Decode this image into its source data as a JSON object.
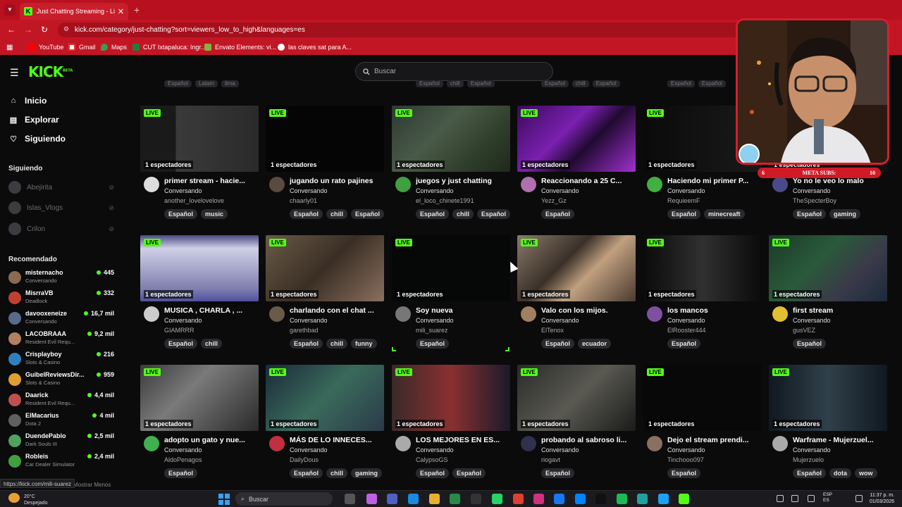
{
  "browser": {
    "tab_title": "Just Chatting Streaming - Live S",
    "tab_close": "✕",
    "new_tab": "+",
    "url": "kick.com/category/just-chatting?sort=viewers_low_to_high&languages=es",
    "bookmarks": [
      "YouTube",
      "Gmail",
      "Maps",
      "CUT Ixtapaluca: Ingr...",
      "Envato Elements: vi...",
      "las claves sat para A..."
    ]
  },
  "header": {
    "logo": "KICK",
    "logo_badge": "BETA",
    "search_placeholder": "Buscar"
  },
  "sidebar": {
    "nav": [
      {
        "label": "Inicio",
        "icon": "home-icon"
      },
      {
        "label": "Explorar",
        "icon": "explore-icon"
      },
      {
        "label": "Siguiendo",
        "icon": "heart-icon"
      }
    ],
    "following_title": "Siguiendo",
    "following": [
      "Abejirita",
      "Islas_Vlogs",
      "Crilon"
    ],
    "recommended_title": "Recomendado",
    "recommended": [
      {
        "name": "misternacho",
        "category": "Conversando",
        "viewers": "445"
      },
      {
        "name": "MisrraVB",
        "category": "Deadlock",
        "viewers": "332"
      },
      {
        "name": "davooxeneize",
        "category": "Conversando",
        "viewers": "16,7 mil"
      },
      {
        "name": "LACOBRAAA",
        "category": "Resident Evil Requ...",
        "viewers": "9,2 mil"
      },
      {
        "name": "Crisplayboy",
        "category": "Slots & Casino",
        "viewers": "216"
      },
      {
        "name": "GuibelReviewsDir...",
        "category": "Slots & Casino",
        "viewers": "959"
      },
      {
        "name": "Daarick",
        "category": "Resident Evil Requ...",
        "viewers": "4,4 mil"
      },
      {
        "name": "ElMacarius",
        "category": "Dota 2",
        "viewers": "4 mil"
      },
      {
        "name": "DuendePablo",
        "category": "Dark Souls III",
        "viewers": "2,5 mil"
      },
      {
        "name": "Robleis",
        "category": "Car Dealer Simulator",
        "viewers": "2,4 mil"
      }
    ],
    "show_more": "Mostrar Menos",
    "status_url": "https://kick.com/mili-suarez"
  },
  "cut_tags": [
    [
      "Español",
      "Latam",
      "lima"
    ],
    [],
    [
      "Español",
      "chill",
      "Español"
    ],
    [
      "Español",
      "chill",
      "Español"
    ],
    [
      "Español",
      "Español"
    ]
  ],
  "live_label": "LIVE",
  "streams": [
    {
      "title": "primer stream - hacie...",
      "category": "Conversando",
      "user": "another_lovelovelove",
      "viewers": "1 espectadores",
      "tags": [
        "Español",
        "music"
      ]
    },
    {
      "title": "jugando un rato pajines",
      "category": "Conversando",
      "user": "chaarly01",
      "viewers": "1 espectadores",
      "tags": [
        "Español",
        "chill",
        "Español"
      ]
    },
    {
      "title": "juegos y just chatting",
      "category": "Conversando",
      "user": "el_loco_chinete1991",
      "viewers": "1 espectadores",
      "tags": [
        "Español",
        "chill",
        "Español"
      ]
    },
    {
      "title": "Reaccionando a 25 C...",
      "category": "Conversando",
      "user": "Yezz_Gz",
      "viewers": "1 espectadores",
      "tags": [
        "Español"
      ]
    },
    {
      "title": "Haciendo mi primer P...",
      "category": "Conversando",
      "user": "RequieemF",
      "viewers": "1 espectadores",
      "tags": [
        "Español",
        "minecreaft"
      ]
    },
    {
      "title": "Yo no le veo lo malo",
      "category": "Conversando",
      "user": "TheSpecterBoy",
      "viewers": "1 espectadores",
      "tags": [
        "Español",
        "gaming"
      ]
    },
    {
      "title": "MUSICA , CHARLA , ...",
      "category": "Conversando",
      "user": "GIAMRRR",
      "viewers": "1 espectadores",
      "tags": [
        "Español",
        "chill"
      ]
    },
    {
      "title": "charlando con el chat ...",
      "category": "Conversando",
      "user": "garethbad",
      "viewers": "1 espectadores",
      "tags": [
        "Español",
        "chill",
        "funny"
      ]
    },
    {
      "title": "Soy nueva",
      "category": "Conversando",
      "user": "mili_suarez",
      "viewers": "1 espectadores",
      "tags": [
        "Español"
      ]
    },
    {
      "title": "Valo con los mijos.",
      "category": "Conversando",
      "user": "ElTenox",
      "viewers": "1 espectadores",
      "tags": [
        "Español",
        "ecuador"
      ]
    },
    {
      "title": "los mancos",
      "category": "Conversando",
      "user": "ElRooster444",
      "viewers": "1 espectadores",
      "tags": [
        "Español"
      ]
    },
    {
      "title": "first stream",
      "category": "Conversando",
      "user": "gusVEZ",
      "viewers": "1 espectadores",
      "tags": [
        "Español"
      ]
    },
    {
      "title": "adopto un gato y nue...",
      "category": "Conversando",
      "user": "AldoPenagos",
      "viewers": "1 espectadores",
      "tags": [
        "Español"
      ]
    },
    {
      "title": "MÁS DE LO INNECES...",
      "category": "Conversando",
      "user": "DailyDous",
      "viewers": "1 espectadores",
      "tags": [
        "Español",
        "chill",
        "gaming"
      ]
    },
    {
      "title": "LOS MEJORES EN ES...",
      "category": "Conversando",
      "user": "CalypsoGS",
      "viewers": "1 espectadores",
      "tags": [
        "Español",
        "Español"
      ]
    },
    {
      "title": "probando al sabroso li...",
      "category": "Conversando",
      "user": "riogavt",
      "viewers": "1 espectadores",
      "tags": [
        "Español"
      ]
    },
    {
      "title": "Dejo el stream prendi...",
      "category": "Conversando",
      "user": "Tinchooo097",
      "viewers": "1 espectadores",
      "tags": [
        "Español"
      ]
    },
    {
      "title": "Warframe - Mujerzuel...",
      "category": "Conversando",
      "user": "Mujerzuelo",
      "viewers": "1 espectadores",
      "tags": [
        "Español",
        "dota",
        "wow"
      ]
    }
  ],
  "overlay": {
    "meta_label": "META SUBS:",
    "meta_left": "6",
    "meta_right": "10"
  },
  "taskbar": {
    "temp": "20°C",
    "weather": "Despejado",
    "search": "Buscar",
    "lang1": "ESP",
    "lang2": "ES",
    "time": "11:37 p. m.",
    "date": "01/03/2026"
  },
  "colors": {
    "brand": "#53fc18",
    "chrome": "#c31624"
  }
}
